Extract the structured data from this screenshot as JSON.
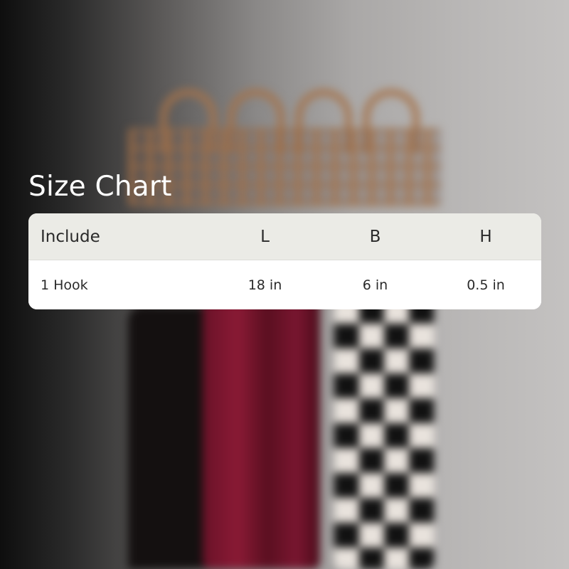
{
  "title": "Size Chart",
  "table": {
    "headers": [
      "Include",
      "L",
      "B",
      "H"
    ],
    "rows": [
      [
        "1 Hook",
        "18 in",
        "6 in",
        "0.5 in"
      ]
    ]
  },
  "colors": {
    "header_bg": "#ebebe6",
    "row_bg": "#ffffff",
    "title_text": "#ffffff",
    "cell_text": "#2a2a2a"
  }
}
